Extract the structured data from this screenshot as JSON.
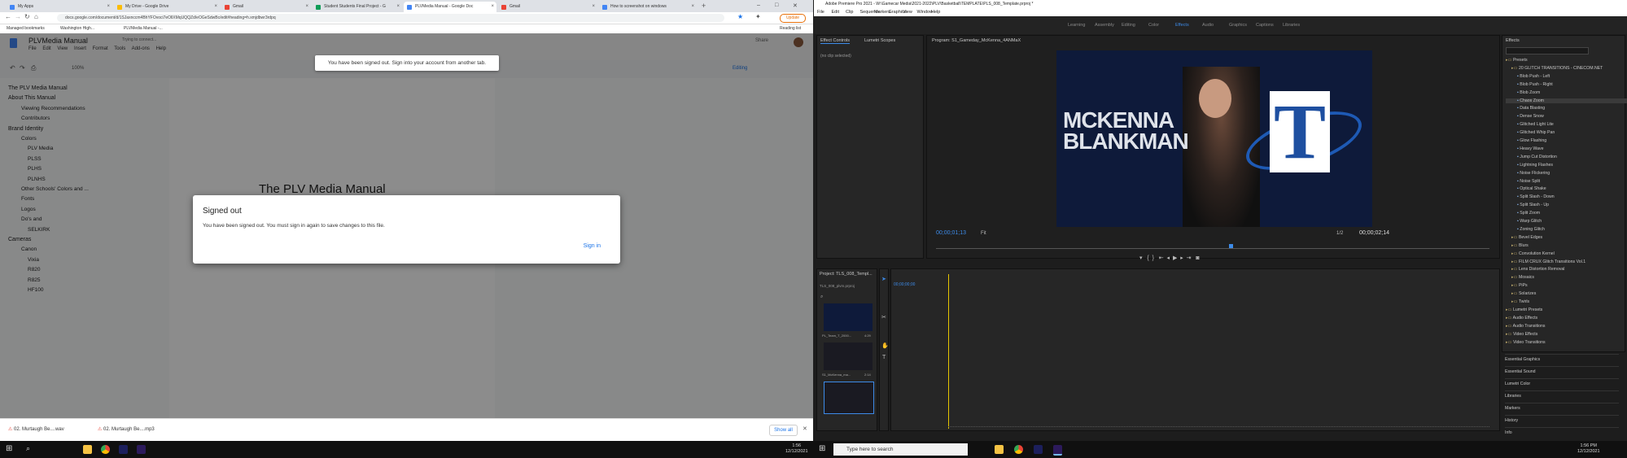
{
  "chrome": {
    "tabs": [
      {
        "label": "My Apps",
        "color": "#4285f4"
      },
      {
        "label": "My Drive - Google Drive",
        "color": "#fbbc04"
      },
      {
        "label": "Gmail",
        "color": "#ea4335"
      },
      {
        "label": "Student Students Final Project - G",
        "color": "#0f9d58"
      },
      {
        "label": "PLVMedia Manual - Google Doc",
        "color": "#4285f4"
      },
      {
        "label": "Gmail",
        "color": "#ea4335"
      },
      {
        "label": "How to screenshot on windows",
        "color": "#4285f4"
      }
    ],
    "url": "docs.google.com/document/d/1SJaxnccm4BhYFOvoci7eOllXMqUQQZd/eOGeSdwBc/edit#heading=h.xmjdbwr3rdpq",
    "update_label": "Update",
    "bookmarks": [
      "Managed bookmarks",
      "Washington High...",
      "PLVMedia Manual -..."
    ],
    "reading_list": "Reading list",
    "doc_title": "PLVMedia Manual",
    "doc_menu": [
      "File",
      "Edit",
      "View",
      "Insert",
      "Format",
      "Tools",
      "Add-ons",
      "Help"
    ],
    "doc_status": "Trying to connect...",
    "share_label": "Share",
    "editing_label": "Editing",
    "zoom": "100%",
    "outline": [
      {
        "label": "The PLV Media Manual",
        "level": 0
      },
      {
        "label": "About This Manual",
        "level": 0
      },
      {
        "label": "Viewing Recommendations",
        "level": 1
      },
      {
        "label": "Contributors",
        "level": 1
      },
      {
        "label": "Brand Identity",
        "level": 0
      },
      {
        "label": "Colors",
        "level": 1
      },
      {
        "label": "PLV Media",
        "level": 2
      },
      {
        "label": "PLSS",
        "level": 2
      },
      {
        "label": "PLHS",
        "level": 2
      },
      {
        "label": "PLNHS",
        "level": 2
      },
      {
        "label": "Other Schools' Colors and ...",
        "level": 1
      },
      {
        "label": "Fonts",
        "level": 1
      },
      {
        "label": "Logos",
        "level": 1
      },
      {
        "label": "Do's and",
        "level": 1
      },
      {
        "label": "SELKIRK",
        "level": 2
      },
      {
        "label": "Cameras",
        "level": 0
      },
      {
        "label": "Canon",
        "level": 1
      },
      {
        "label": "Vixia",
        "level": 2
      },
      {
        "label": "R820",
        "level": 2
      },
      {
        "label": "R825",
        "level": 2
      },
      {
        "label": "HF100",
        "level": 2
      }
    ],
    "page_heading": "The PLV Media Manual",
    "toast": "You have been signed out. Sign into your account from another tab.",
    "dialog": {
      "title": "Signed out",
      "message": "You have been signed out. You must sign in again to save changes to this file.",
      "button": "Sign in"
    },
    "downloads": [
      "02. Murtaugh Be....wav",
      "02. Murtaugh Be....mp3"
    ],
    "show_all": "Show all"
  },
  "premiere": {
    "title": "Adobe Premiere Pro 2021 - W:\\Gamecar Media\\2021-2022\\PLV\\Basketball\\TEMPLATE\\PLS_008_Template.prproj *",
    "menu": [
      "File",
      "Edit",
      "Clip",
      "Sequence",
      "Markers",
      "Graphics",
      "View",
      "Window",
      "Help"
    ],
    "workspaces": [
      "Learning",
      "Assembly",
      "Editing",
      "Color",
      "Effects",
      "Audio",
      "Graphics",
      "Captions",
      "Libraries"
    ],
    "active_workspace": "Effects",
    "source_tabs": [
      "Effect Controls",
      "Lumetri Scopes"
    ],
    "no_clip": "(no clip selected)",
    "program_label": "Program: S1_Gameday_McKenna_4ANMaX",
    "athlete_first": "MCKENNA",
    "athlete_last": "BLANKMAN",
    "logo_letter": "T",
    "timecode_current": "00;00;01;13",
    "timecode_total": "00;00;02;14",
    "fit_label": "Fit",
    "quality_label": "1/2",
    "project_tab": "Project: TLS_008_Templ...",
    "project_file": "TLS_008_plvm.prproj",
    "project_items": [
      {
        "name": "PL_Team_T_2000...",
        "duration": "4:29"
      },
      {
        "name": "S1_McKenna_ma...",
        "duration": "2:14"
      },
      {
        "name": "",
        "duration": ""
      }
    ],
    "timeline_ticks": "00;00;00;00",
    "effects_tab": "Effects",
    "effects": [
      {
        "label": "Presets",
        "indent": 0,
        "folder": true
      },
      {
        "label": "20 GLITCH TRANSITIONS - CINECOM.NET",
        "indent": 1,
        "folder": true
      },
      {
        "label": "Blob Push - Left",
        "indent": 2,
        "folder": false
      },
      {
        "label": "Blob Push - Right",
        "indent": 2,
        "folder": false
      },
      {
        "label": "Blob Zoom",
        "indent": 2,
        "folder": false
      },
      {
        "label": "Chaos Zoom",
        "indent": 2,
        "folder": false,
        "selected": true
      },
      {
        "label": "Data Blasting",
        "indent": 2,
        "folder": false
      },
      {
        "label": "Dense Snow",
        "indent": 2,
        "folder": false
      },
      {
        "label": "Glitched Light Lite",
        "indent": 2,
        "folder": false
      },
      {
        "label": "Glitched Whip Pan",
        "indent": 2,
        "folder": false
      },
      {
        "label": "Glow Flashing",
        "indent": 2,
        "folder": false
      },
      {
        "label": "Heavy Wave",
        "indent": 2,
        "folder": false
      },
      {
        "label": "Jump Cut Distortion",
        "indent": 2,
        "folder": false
      },
      {
        "label": "Lightning Flashes",
        "indent": 2,
        "folder": false
      },
      {
        "label": "Noise Flickering",
        "indent": 2,
        "folder": false
      },
      {
        "label": "Noise Split",
        "indent": 2,
        "folder": false
      },
      {
        "label": "Optical Shake",
        "indent": 2,
        "folder": false
      },
      {
        "label": "Split Slash - Down",
        "indent": 2,
        "folder": false
      },
      {
        "label": "Split Slash - Up",
        "indent": 2,
        "folder": false
      },
      {
        "label": "Split Zoom",
        "indent": 2,
        "folder": false
      },
      {
        "label": "Warp Glitch",
        "indent": 2,
        "folder": false
      },
      {
        "label": "Zoning Glitch",
        "indent": 2,
        "folder": false
      },
      {
        "label": "Bevel Edges",
        "indent": 1,
        "folder": true
      },
      {
        "label": "Blurs",
        "indent": 1,
        "folder": true
      },
      {
        "label": "Convolution Kernel",
        "indent": 1,
        "folder": true
      },
      {
        "label": "FILM CRUX Glitch Transitions Vol.1",
        "indent": 1,
        "folder": true
      },
      {
        "label": "Lens Distortion Removal",
        "indent": 1,
        "folder": true
      },
      {
        "label": "Mosaics",
        "indent": 1,
        "folder": true
      },
      {
        "label": "PiPs",
        "indent": 1,
        "folder": true
      },
      {
        "label": "Solarizes",
        "indent": 1,
        "folder": true
      },
      {
        "label": "Twirls",
        "indent": 1,
        "folder": true
      },
      {
        "label": "Lumetri Presets",
        "indent": 0,
        "folder": true
      },
      {
        "label": "Audio Effects",
        "indent": 0,
        "folder": true
      },
      {
        "label": "Audio Transitions",
        "indent": 0,
        "folder": true
      },
      {
        "label": "Video Effects",
        "indent": 0,
        "folder": true
      },
      {
        "label": "Video Transitions",
        "indent": 0,
        "folder": true
      }
    ],
    "side_panels": [
      "Essential Graphics",
      "Essential Sound",
      "Lumetri Color",
      "Libraries",
      "Markers",
      "History",
      "Info"
    ]
  },
  "taskbar": {
    "search_placeholder": "Type here to search",
    "left_clock_time": "1:56",
    "left_clock_date": "12/12/2021",
    "right_clock_time": "1:56 PM",
    "right_clock_date": "12/12/2021"
  }
}
